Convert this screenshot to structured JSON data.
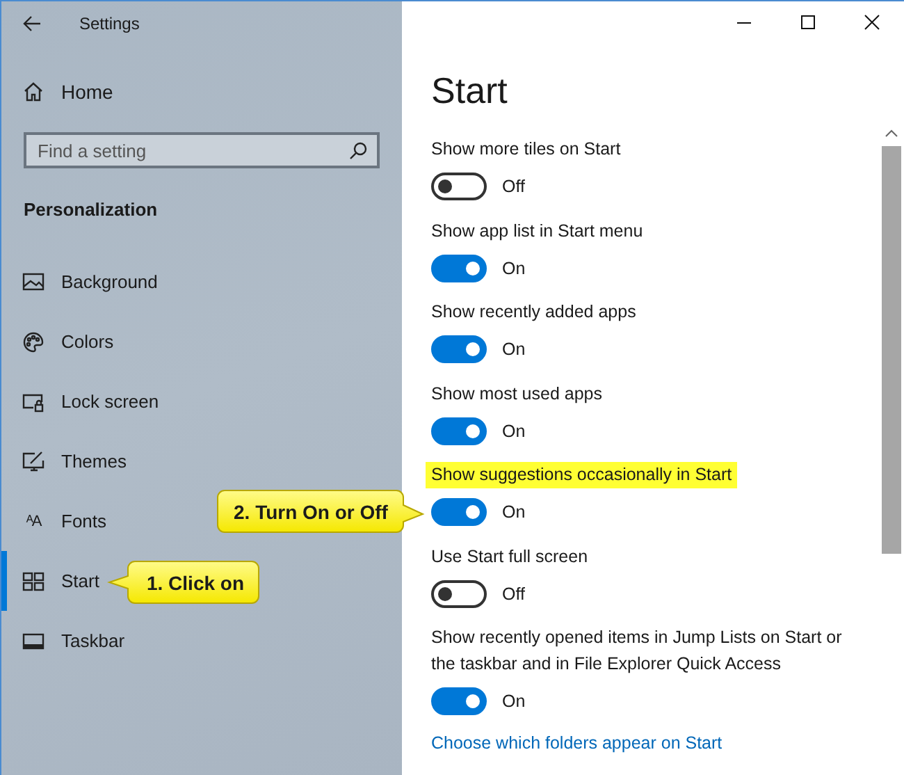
{
  "window": {
    "title": "Settings"
  },
  "sidebar": {
    "home": "Home",
    "search": {
      "placeholder": "Find a setting"
    },
    "section": "Personalization",
    "items": [
      {
        "label": "Background",
        "selected": false
      },
      {
        "label": "Colors",
        "selected": false
      },
      {
        "label": "Lock screen",
        "selected": false
      },
      {
        "label": "Themes",
        "selected": false
      },
      {
        "label": "Fonts",
        "selected": false,
        "glyph": "ᴬA"
      },
      {
        "label": "Start",
        "selected": true
      },
      {
        "label": "Taskbar",
        "selected": false
      }
    ]
  },
  "content": {
    "heading": "Start",
    "settings": [
      {
        "label": "Show more tiles on Start",
        "on": false,
        "state_text": "Off",
        "highlighted": false
      },
      {
        "label": "Show app list in Start menu",
        "on": true,
        "state_text": "On",
        "highlighted": false
      },
      {
        "label": "Show recently added apps",
        "on": true,
        "state_text": "On",
        "highlighted": false
      },
      {
        "label": "Show most used apps",
        "on": true,
        "state_text": "On",
        "highlighted": false
      },
      {
        "label": "Show suggestions occasionally in Start",
        "on": true,
        "state_text": "On",
        "highlighted": true
      },
      {
        "label": "Use Start full screen",
        "on": false,
        "state_text": "Off",
        "highlighted": false
      },
      {
        "label": "Show recently opened items in Jump Lists on Start or the taskbar and in File Explorer Quick Access",
        "on": true,
        "state_text": "On",
        "highlighted": false
      }
    ],
    "link": "Choose which folders appear on Start"
  },
  "callouts": [
    {
      "text": "1. Click on",
      "kind": "left"
    },
    {
      "text": "2. Turn On or Off",
      "kind": "right"
    }
  ]
}
